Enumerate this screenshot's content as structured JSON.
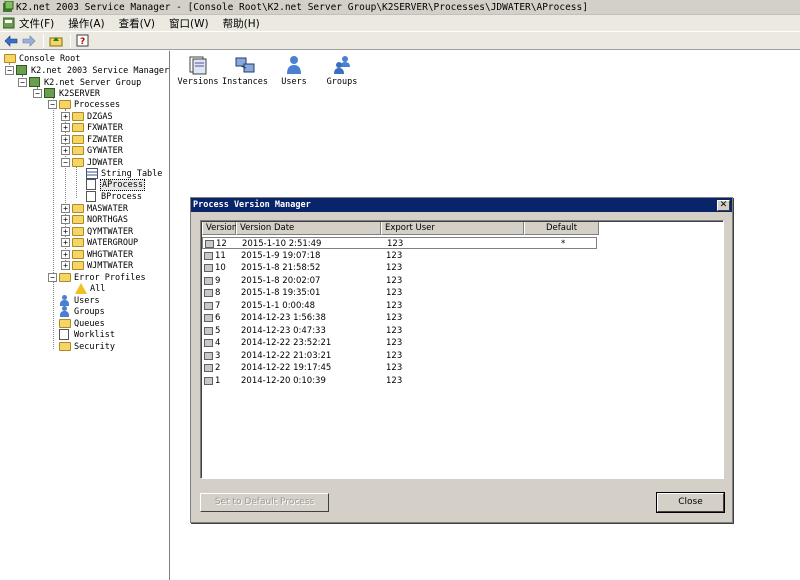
{
  "window": {
    "title": "K2.net 2003 Service Manager - [Console Root\\K2.net Server Group\\K2SERVER\\Processes\\JDWATER\\AProcess]"
  },
  "menu": {
    "items": [
      "文件(F)",
      "操作(A)",
      "查看(V)",
      "窗口(W)",
      "帮助(H)"
    ]
  },
  "toolbar": {
    "buttons": [
      "back-icon",
      "forward-icon",
      "up-folder-icon",
      "help-icon"
    ]
  },
  "tree": {
    "root": "Console Root",
    "service_manager": "K2.net 2003 Service Manager",
    "server_group": "K2.net Server Group",
    "server": "K2SERVER",
    "processes": "Processes",
    "folders_before": [
      "DZGAS",
      "FXWATER",
      "FZWATER",
      "GYWATER",
      "JDWATER"
    ],
    "jdwater_children": [
      "String Table",
      "AProcess",
      "BProcess"
    ],
    "folders_after": [
      "MASWATER",
      "NORTHGAS",
      "QYMTWATER",
      "WATERGROUP",
      "WHGTWATER",
      "WJMTWATER"
    ],
    "error_profiles": "Error Profiles",
    "error_all": "All",
    "others": [
      "Users",
      "Groups",
      "Queues",
      "Worklist",
      "Security"
    ]
  },
  "right_pane": {
    "icons": [
      "Versions",
      "Instances",
      "Users",
      "Groups"
    ]
  },
  "dialog": {
    "title": "Process Version Manager",
    "columns": [
      "Version",
      "Version Date",
      "Export User",
      "Default"
    ],
    "rows": [
      {
        "version": "12",
        "date": "2015-1-10 2:51:49",
        "user": "123",
        "default": "*"
      },
      {
        "version": "11",
        "date": "2015-1-9 19:07:18",
        "user": "123",
        "default": ""
      },
      {
        "version": "10",
        "date": "2015-1-8 21:58:52",
        "user": "123",
        "default": ""
      },
      {
        "version": "9",
        "date": "2015-1-8 20:02:07",
        "user": "123",
        "default": ""
      },
      {
        "version": "8",
        "date": "2015-1-8 19:35:01",
        "user": "123",
        "default": ""
      },
      {
        "version": "7",
        "date": "2015-1-1 0:00:48",
        "user": "123",
        "default": ""
      },
      {
        "version": "6",
        "date": "2014-12-23 1:56:38",
        "user": "123",
        "default": ""
      },
      {
        "version": "5",
        "date": "2014-12-23 0:47:33",
        "user": "123",
        "default": ""
      },
      {
        "version": "4",
        "date": "2014-12-22 23:52:21",
        "user": "123",
        "default": ""
      },
      {
        "version": "3",
        "date": "2014-12-22 21:03:21",
        "user": "123",
        "default": ""
      },
      {
        "version": "2",
        "date": "2014-12-22 19:17:45",
        "user": "123",
        "default": ""
      },
      {
        "version": "1",
        "date": "2014-12-20 0:10:39",
        "user": "123",
        "default": ""
      }
    ],
    "set_default_label": "Set to Default Process",
    "close_label": "Close"
  }
}
